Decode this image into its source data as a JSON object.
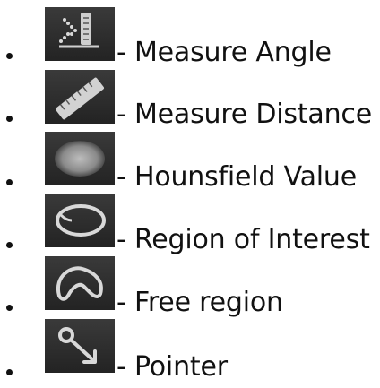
{
  "tools": [
    {
      "icon": "measure-angle-icon",
      "label": "- Measure Angle"
    },
    {
      "icon": "measure-distance-icon",
      "label": "- Measure Distance"
    },
    {
      "icon": "hounsfield-value-icon",
      "label": "- Hounsfield Value"
    },
    {
      "icon": "region-of-interest-icon",
      "label": "- Region of Interest"
    },
    {
      "icon": "free-region-icon",
      "label": "- Free region"
    },
    {
      "icon": "pointer-icon",
      "label": "- Pointer"
    }
  ],
  "colors": {
    "icon_background": "#2b2b2b",
    "icon_foreground": "#d0d0d0",
    "text": "#111111"
  }
}
